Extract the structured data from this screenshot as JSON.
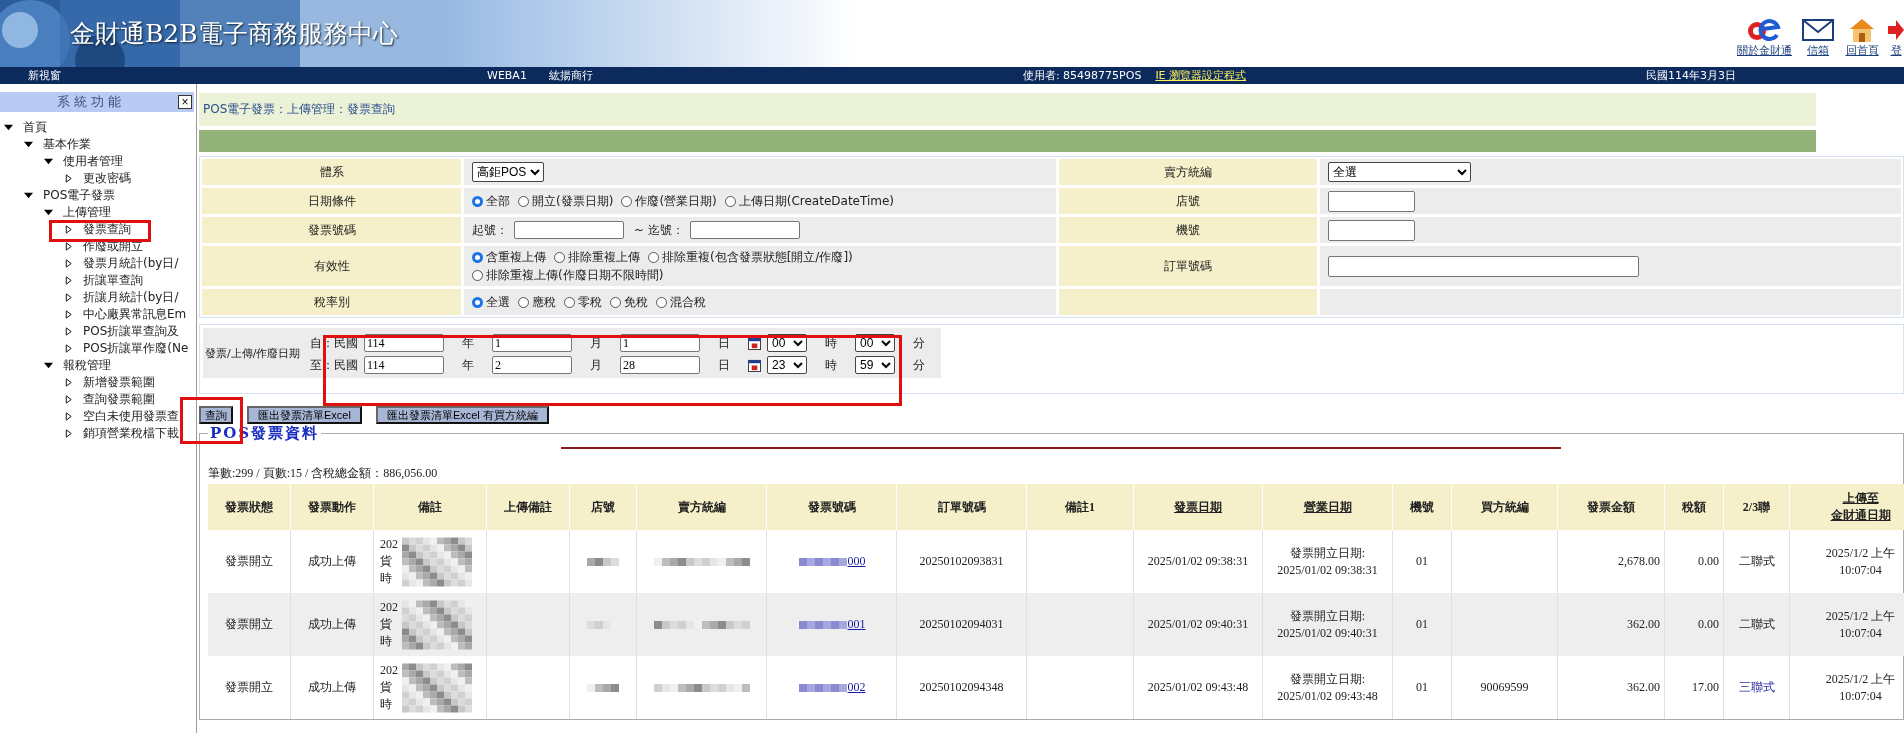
{
  "header": {
    "title": "金財通B2B電子商務服務中心",
    "links": [
      {
        "label": "關於金財通",
        "kind": "about"
      },
      {
        "label": "信箱",
        "kind": "mail"
      },
      {
        "label": "回首頁",
        "kind": "home"
      },
      {
        "label": "登",
        "kind": "logout"
      }
    ]
  },
  "status_bar": {
    "new_window": "新視窗",
    "system": "WEBA1",
    "company": "紘揚商行",
    "user": "使用者: 85498775POS",
    "settings_link": "IE 瀏覽器設定程式",
    "date": "民國114年3月3日"
  },
  "sidebar": {
    "title": "系 統 功 能",
    "close": "×",
    "tree": [
      {
        "label": "首頁",
        "expanded": true,
        "children": [
          {
            "label": "基本作業",
            "expanded": true,
            "children": [
              {
                "label": "使用者管理",
                "expanded": true,
                "children": [
                  {
                    "label": "更改密碼"
                  }
                ]
              }
            ]
          },
          {
            "label": "POS電子發票",
            "expanded": true,
            "children": [
              {
                "label": "上傳管理",
                "expanded": true,
                "children": [
                  {
                    "label": "發票查詢"
                  },
                  {
                    "label": "作廢或開立"
                  },
                  {
                    "label": "發票月統計(by日/"
                  },
                  {
                    "label": "折讓單查詢"
                  },
                  {
                    "label": "折讓月統計(by日/"
                  },
                  {
                    "label": "中心廠異常訊息Em"
                  },
                  {
                    "label": "POS折讓單查詢及"
                  },
                  {
                    "label": "POS折讓單作廢(Ne"
                  }
                ]
              },
              {
                "label": "報稅管理",
                "expanded": true,
                "children": [
                  {
                    "label": "新增發票範圍"
                  },
                  {
                    "label": "查詢發票範圍"
                  },
                  {
                    "label": "空白未使用發票查"
                  },
                  {
                    "label": "銷項營業稅檔下載"
                  }
                ]
              }
            ]
          }
        ]
      }
    ]
  },
  "breadcrumb": "POS電子發票：上傳管理：發票查詢",
  "filters": [
    {
      "label": "體系",
      "kind": "select",
      "value": "高鉅POS"
    },
    {
      "label": "日期條件",
      "kind": "radio",
      "options": [
        {
          "label": "全部",
          "selected": true
        },
        {
          "label": "開立(發票日期)",
          "selected": false
        },
        {
          "label": "作廢(營業日期)",
          "selected": false
        },
        {
          "label": "上傳日期(CreateDateTime)",
          "selected": false
        }
      ]
    },
    {
      "label": "發票號碼",
      "kind": "range",
      "from_label": "起號：",
      "to_label": "~ 迄號："
    },
    {
      "label": "有效性",
      "kind": "radio",
      "options": [
        {
          "label": "含重複上傳",
          "selected": true
        },
        {
          "label": "排除重複上傳",
          "selected": false
        },
        {
          "label": "排除重複(包含發票狀態[開立/作廢])",
          "selected": false
        },
        {
          "label": "排除重複上傳(作廢日期不限時間)",
          "selected": false
        }
      ]
    },
    {
      "label": "稅率別",
      "kind": "radio",
      "options": [
        {
          "label": "全選",
          "selected": true
        },
        {
          "label": "應稅",
          "selected": false
        },
        {
          "label": "零稅",
          "selected": false
        },
        {
          "label": "免稅",
          "selected": false
        },
        {
          "label": "混合稅",
          "selected": false
        }
      ]
    }
  ],
  "filters_right": [
    {
      "label": "賣方統編",
      "kind": "select",
      "value": "全選"
    },
    {
      "label": "店號",
      "kind": "input"
    },
    {
      "label": "機號",
      "kind": "input"
    },
    {
      "label": "訂單號碼",
      "kind": "wide_input"
    },
    {
      "kind": "empty"
    }
  ],
  "date_range": {
    "label": "發票/上傳/作廢日期",
    "rows": [
      {
        "prefix": "自：民國",
        "year": "114",
        "year_unit": "年",
        "month": "1",
        "month_unit": "月",
        "day": "1",
        "day_unit": "日",
        "hour": "00",
        "hour_unit": "時",
        "minute": "00",
        "minute_unit": "分"
      },
      {
        "prefix": "至：民國",
        "year": "114",
        "year_unit": "年",
        "month": "2",
        "month_unit": "月",
        "day": "28",
        "day_unit": "日",
        "hour": "23",
        "hour_unit": "時",
        "minute": "59",
        "minute_unit": "分"
      }
    ]
  },
  "buttons": [
    "查詢",
    "匯出發票清單Excel",
    "匯出發票清單Excel 有買方統編"
  ],
  "results": {
    "legend": "POS發票資料",
    "summary": "筆數:299 / 頁數:15 / 含稅總金額：886,056.00",
    "columns": [
      {
        "label": "發票狀態",
        "sortable": false
      },
      {
        "label": "發票動作",
        "sortable": false
      },
      {
        "label": "備註",
        "sortable": false
      },
      {
        "label": "上傳備註",
        "sortable": false
      },
      {
        "label": "店號",
        "sortable": false
      },
      {
        "label": "賣方統編",
        "sortable": false
      },
      {
        "label": "發票號碼",
        "sortable": false
      },
      {
        "label": "訂單號碼",
        "sortable": false
      },
      {
        "label": "備註1",
        "sortable": false
      },
      {
        "label": "發票日期",
        "sortable": true
      },
      {
        "label": "營業日期",
        "sortable": true
      },
      {
        "label": "機號",
        "sortable": false
      },
      {
        "label": "買方統編",
        "sortable": false
      },
      {
        "label": "發票金額",
        "sortable": false
      },
      {
        "label": "稅額",
        "sortable": false
      },
      {
        "label": "2/3聯",
        "sortable": false
      },
      {
        "label": [
          "上傳至",
          "金財通日期"
        ],
        "sortable": true
      }
    ],
    "rows": [
      {
        "status": "發票開立",
        "action": "成功上傳",
        "remark": [
          "202",
          "貨時"
        ],
        "invoice_suffix": "000",
        "order_no": "20250102093831",
        "invoice_date": "2025/01/02 09:38:31",
        "business_date_label": "發票開立日期:",
        "business_date": "2025/01/02 09:38:31",
        "machine": "01",
        "amount": "2,678.00",
        "tax": "0.00",
        "copy_type": "二聯式",
        "copy_type_linked": false,
        "upload_date": [
          "2025/1/2 上午",
          "10:07:04"
        ]
      },
      {
        "status": "發票開立",
        "action": "成功上傳",
        "remark": [
          "202",
          "貨時"
        ],
        "invoice_suffix": "001",
        "order_no": "20250102094031",
        "invoice_date": "2025/01/02 09:40:31",
        "business_date_label": "發票開立日期:",
        "business_date": "2025/01/02 09:40:31",
        "machine": "01",
        "amount": "362.00",
        "tax": "0.00",
        "copy_type": "二聯式",
        "copy_type_linked": false,
        "upload_date": [
          "2025/1/2 上午",
          "10:07:04"
        ]
      },
      {
        "status": "發票開立",
        "action": "成功上傳",
        "remark": [
          "202",
          "貨時"
        ],
        "invoice_suffix": "002",
        "order_no": "20250102094348",
        "invoice_date": "2025/01/02 09:43:48",
        "business_date_label": "發票開立日期:",
        "business_date": "2025/01/02 09:43:48",
        "machine": "01",
        "buyer_id": "90069599",
        "amount": "362.00",
        "tax": "17.00",
        "copy_type": "三聯式",
        "copy_type_linked": true,
        "upload_date": [
          "2025/1/2 上午",
          "10:07:04"
        ]
      }
    ]
  }
}
